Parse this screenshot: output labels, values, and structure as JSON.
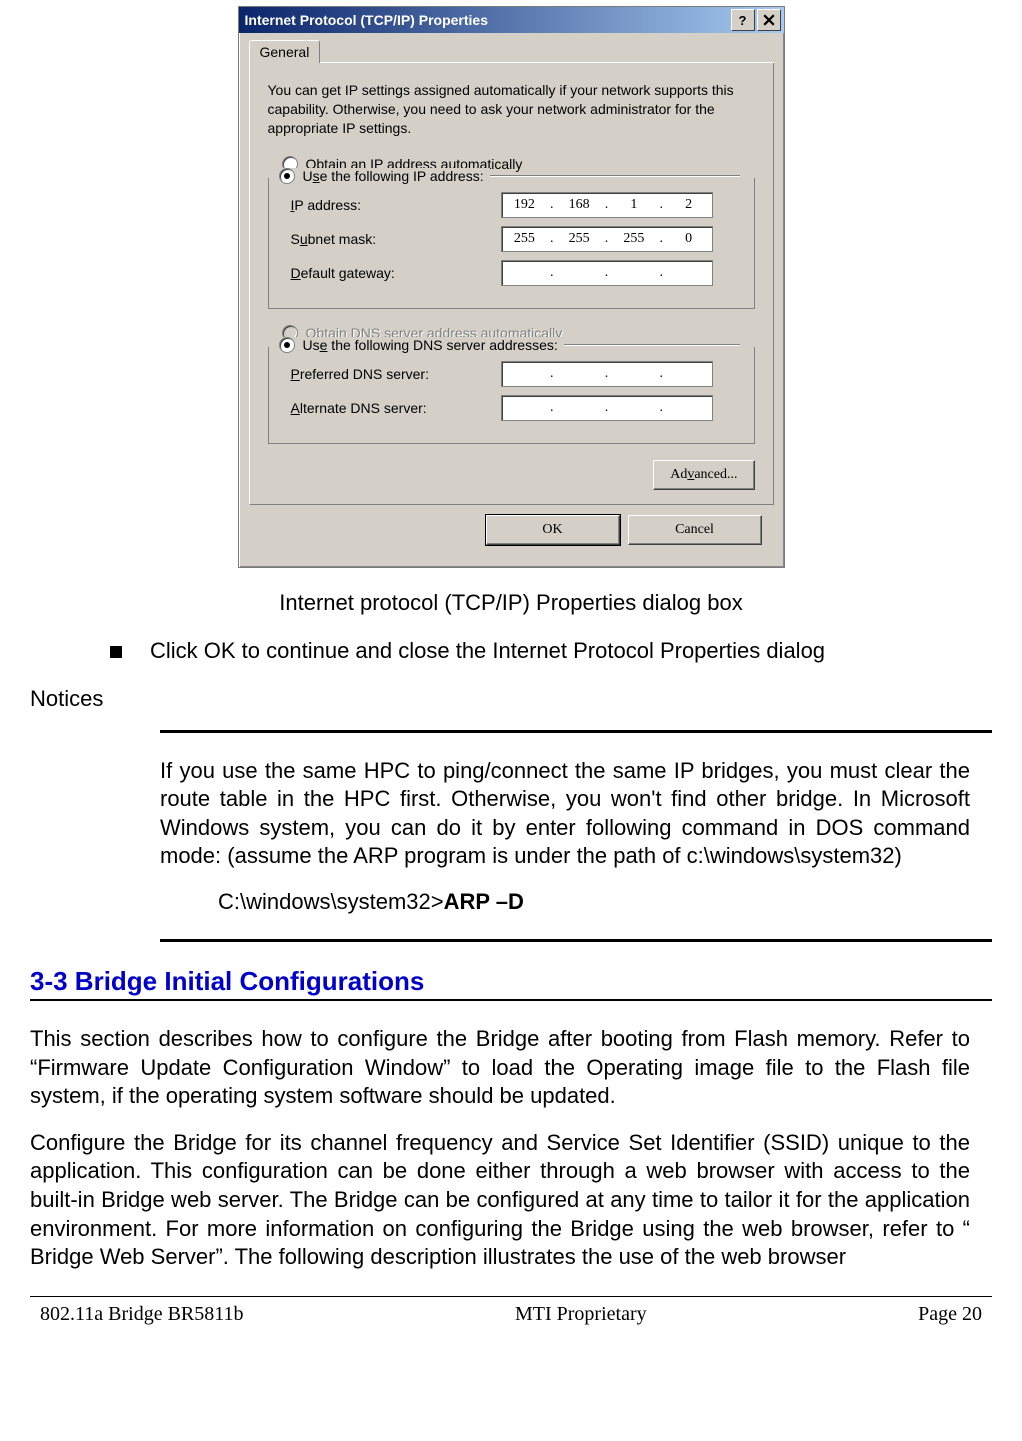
{
  "dialog": {
    "title": "Internet Protocol (TCP/IP) Properties",
    "tab": "General",
    "desc": "You can get IP settings assigned automatically if your network supports this capability. Otherwise, you need to ask your network administrator for the appropriate IP settings.",
    "radio_obtain_ip": "Obtain an IP address automatically",
    "radio_use_ip": "Use the following IP address:",
    "lbl_ip": "IP address:",
    "lbl_subnet": "Subnet mask:",
    "lbl_gateway": "Default gateway:",
    "ip": {
      "a": "192",
      "b": "168",
      "c": "1",
      "d": "2"
    },
    "subnet": {
      "a": "255",
      "b": "255",
      "c": "255",
      "d": "0"
    },
    "gateway": {
      "a": "",
      "b": "",
      "c": "",
      "d": ""
    },
    "radio_obtain_dns": "Obtain DNS server address automatically",
    "radio_use_dns": "Use the following DNS server addresses:",
    "lbl_pref_dns": "Preferred DNS server:",
    "lbl_alt_dns": "Alternate DNS server:",
    "pref_dns": {
      "a": "",
      "b": "",
      "c": "",
      "d": ""
    },
    "alt_dns": {
      "a": "",
      "b": "",
      "c": "",
      "d": ""
    },
    "btn_advanced": "Advanced...",
    "btn_ok": "OK",
    "btn_cancel": "Cancel"
  },
  "caption": "Internet protocol (TCP/IP) Properties dialog box",
  "bullet_text": "Click OK to continue and close the Internet Protocol Properties dialog",
  "notices_label": "Notices",
  "notice_body": "If you use the same HPC to ping/connect the same IP bridges, you must clear the route table in the HPC first. Otherwise, you won't find other bridge. In Microsoft Windows system, you can do it by enter following command in DOS command mode: (assume the ARP program is under the path of c:\\windows\\system32)",
  "cmd_prefix": "C:\\windows\\system32>",
  "cmd_bold": "ARP –D",
  "section_title": "3-3 Bridge Initial Configurations",
  "para1": "This section describes how to configure the Bridge after booting from Flash memory. Refer to “Firmware Update Configuration Window”  to load the Operating image file to the Flash file system, if the operating system software should be updated.",
  "para2": "Configure the Bridge for its channel frequency and Service Set Identifier (SSID) unique to the application. This configuration can be done either through a web browser with access to the built-in Bridge web server. The Bridge can be configured at any time to tailor it for the application environment. For more information on configuring the Bridge using the web browser, refer to “ Bridge Web Server”. The following description illustrates the use of the web browser",
  "footer": {
    "left": "802.11a Bridge  BR5811b",
    "center": "MTI Proprietary",
    "right": "Page 20"
  }
}
